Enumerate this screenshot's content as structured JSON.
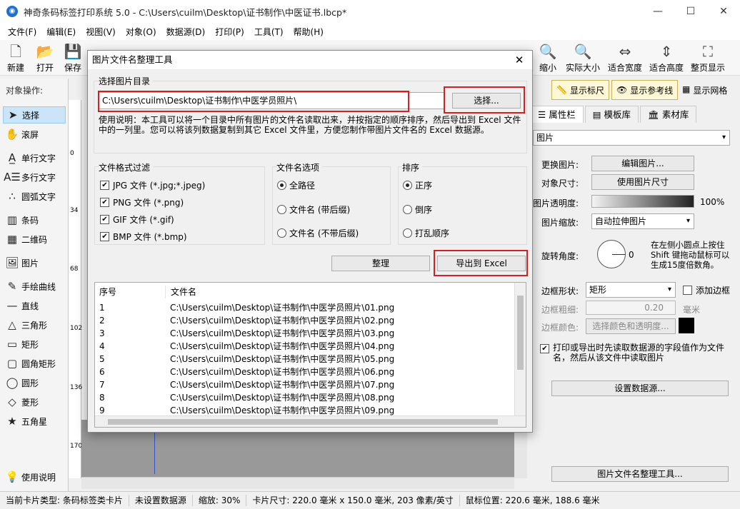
{
  "window": {
    "title": "神奇条码标签打印系统 5.0 - C:\\Users\\cuilm\\Desktop\\证书制作\\中医证书.lbcp*"
  },
  "menu": [
    "文件(F)",
    "编辑(E)",
    "视图(V)",
    "对象(O)",
    "数据源(D)",
    "打印(P)",
    "工具(T)",
    "帮助(H)"
  ],
  "toolbar": {
    "left": [
      {
        "label": "新建",
        "icon": "new-file-icon"
      },
      {
        "label": "打开",
        "icon": "open-icon"
      },
      {
        "label": "保存",
        "icon": "save-icon"
      }
    ],
    "right": [
      {
        "label": "缩小",
        "icon": "zoom-out-icon"
      },
      {
        "label": "实际大小",
        "icon": "actual-size-icon"
      },
      {
        "label": "适合宽度",
        "icon": "fit-width-icon"
      },
      {
        "label": "适合高度",
        "icon": "fit-height-icon"
      },
      {
        "label": "整页显示",
        "icon": "full-page-icon"
      }
    ]
  },
  "left_tools": {
    "header": "对象操作:",
    "items": [
      "选择",
      "滚屏",
      "单行文字",
      "多行文字",
      "圆弧文字",
      "条码",
      "二维码",
      "图片",
      "手绘曲线",
      "直线",
      "三角形",
      "矩形",
      "圆角矩形",
      "圆形",
      "菱形",
      "五角星"
    ],
    "help": "使用说明"
  },
  "ruler_labels": [
    "0",
    "34",
    "68",
    "102",
    "136",
    "170"
  ],
  "right_panel": {
    "show_ruler": "显示标尺",
    "show_guides": "显示参考线",
    "show_grid": "显示网格",
    "tabs": [
      "属性栏",
      "模板库",
      "素材库"
    ],
    "object_type": "图片",
    "change_image_label": "更换图片:",
    "edit_image_btn": "编辑图片...",
    "size_label": "对象尺寸:",
    "use_size_btn": "使用图片尺寸",
    "opacity_label": "图片透明度:",
    "opacity_value": "100%",
    "scale_label": "图片缩放:",
    "scale_value": "自动拉伸图片",
    "rotate_label": "旋转角度:",
    "rotate_value": "0",
    "rotate_hint": "在左侧小圆点上按住Shift 键拖动鼠标可以生成15度倍数角。",
    "border_shape_label": "边框形状:",
    "border_shape_value": "矩形",
    "add_border": "添加边框",
    "border_width_label": "边框粗细:",
    "border_width_value": "0.20",
    "border_width_unit": "毫米",
    "border_color_label": "边框颜色:",
    "border_color_btn": "选择颜色和透明度...",
    "print_read_chk": "打印或导出时先读取数据源的字段值作为文件名，然后从该文件中读取图片",
    "set_datasource_btn": "设置数据源...",
    "organize_tool_btn": "图片文件名整理工具..."
  },
  "status": {
    "card_type": "当前卡片类型: 条码标签类卡片",
    "datasource": "未设置数据源",
    "zoom": "缩放: 30%",
    "card_size": "卡片尺寸: 220.0 毫米 x 150.0 毫米, 203 像素/英寸",
    "mouse_pos": "鼠标位置: 220.6 毫米, 188.6 毫米"
  },
  "dialog": {
    "title": "图片文件名整理工具",
    "dir_group": "选择图片目录",
    "dir_value": "C:\\Users\\cuilm\\Desktop\\证书制作\\中医学员照片\\",
    "choose_btn": "选择...",
    "instructions": "使用说明：本工具可以将一个目录中所有图片的文件名读取出来，并按指定的顺序排序，然后导出到 Excel 文件中的一列里。您可以将该列数据复制到其它 Excel 文件里，方便您制作带图片文件名的 Excel 数据源。",
    "filter_group": "文件格式过滤",
    "filters": [
      "JPG 文件 (*.jpg;*.jpeg)",
      "PNG 文件 (*.png)",
      "GIF 文件 (*.gif)",
      "BMP 文件 (*.bmp)"
    ],
    "name_group": "文件名选项",
    "name_opts": [
      "全路径",
      "文件名 (带后缀)",
      "文件名 (不带后缀)"
    ],
    "sort_group": "排序",
    "sort_opts": [
      "正序",
      "倒序",
      "打乱顺序"
    ],
    "organize_btn": "整理",
    "export_btn": "导出到 Excel",
    "col_index": "序号",
    "col_name": "文件名",
    "rows": [
      [
        "1",
        "C:\\Users\\cuilm\\Desktop\\证书制作\\中医学员照片\\01.png"
      ],
      [
        "2",
        "C:\\Users\\cuilm\\Desktop\\证书制作\\中医学员照片\\02.png"
      ],
      [
        "3",
        "C:\\Users\\cuilm\\Desktop\\证书制作\\中医学员照片\\03.png"
      ],
      [
        "4",
        "C:\\Users\\cuilm\\Desktop\\证书制作\\中医学员照片\\04.png"
      ],
      [
        "5",
        "C:\\Users\\cuilm\\Desktop\\证书制作\\中医学员照片\\05.png"
      ],
      [
        "6",
        "C:\\Users\\cuilm\\Desktop\\证书制作\\中医学员照片\\06.png"
      ],
      [
        "7",
        "C:\\Users\\cuilm\\Desktop\\证书制作\\中医学员照片\\07.png"
      ],
      [
        "8",
        "C:\\Users\\cuilm\\Desktop\\证书制作\\中医学员照片\\08.png"
      ],
      [
        "9",
        "C:\\Users\\cuilm\\Desktop\\证书制作\\中医学员照片\\09.png"
      ]
    ]
  }
}
